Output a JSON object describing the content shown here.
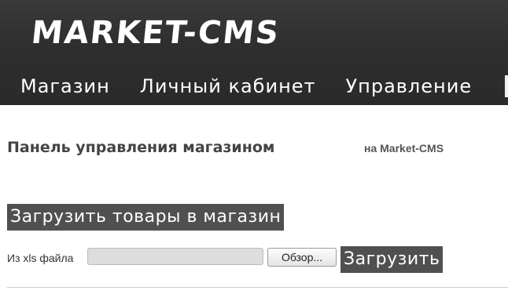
{
  "header": {
    "logo_text": "MARKET-CMS",
    "nav": [
      {
        "label": "Магазин"
      },
      {
        "label": "Личный кабинет"
      },
      {
        "label": "Управление"
      }
    ]
  },
  "main": {
    "panel_title": "Панель управления магазином",
    "panel_subtitle": "на Market-CMS",
    "section_heading": "Загрузить товары в магазин",
    "upload": {
      "file_label": "Из xls файла",
      "file_value": "",
      "browse_label": "Обзор...",
      "submit_label": "Загрузить"
    }
  },
  "colors": {
    "header_bg": "#2f2f2f",
    "accent_button_bg": "#505050",
    "title_text": "#444444"
  }
}
